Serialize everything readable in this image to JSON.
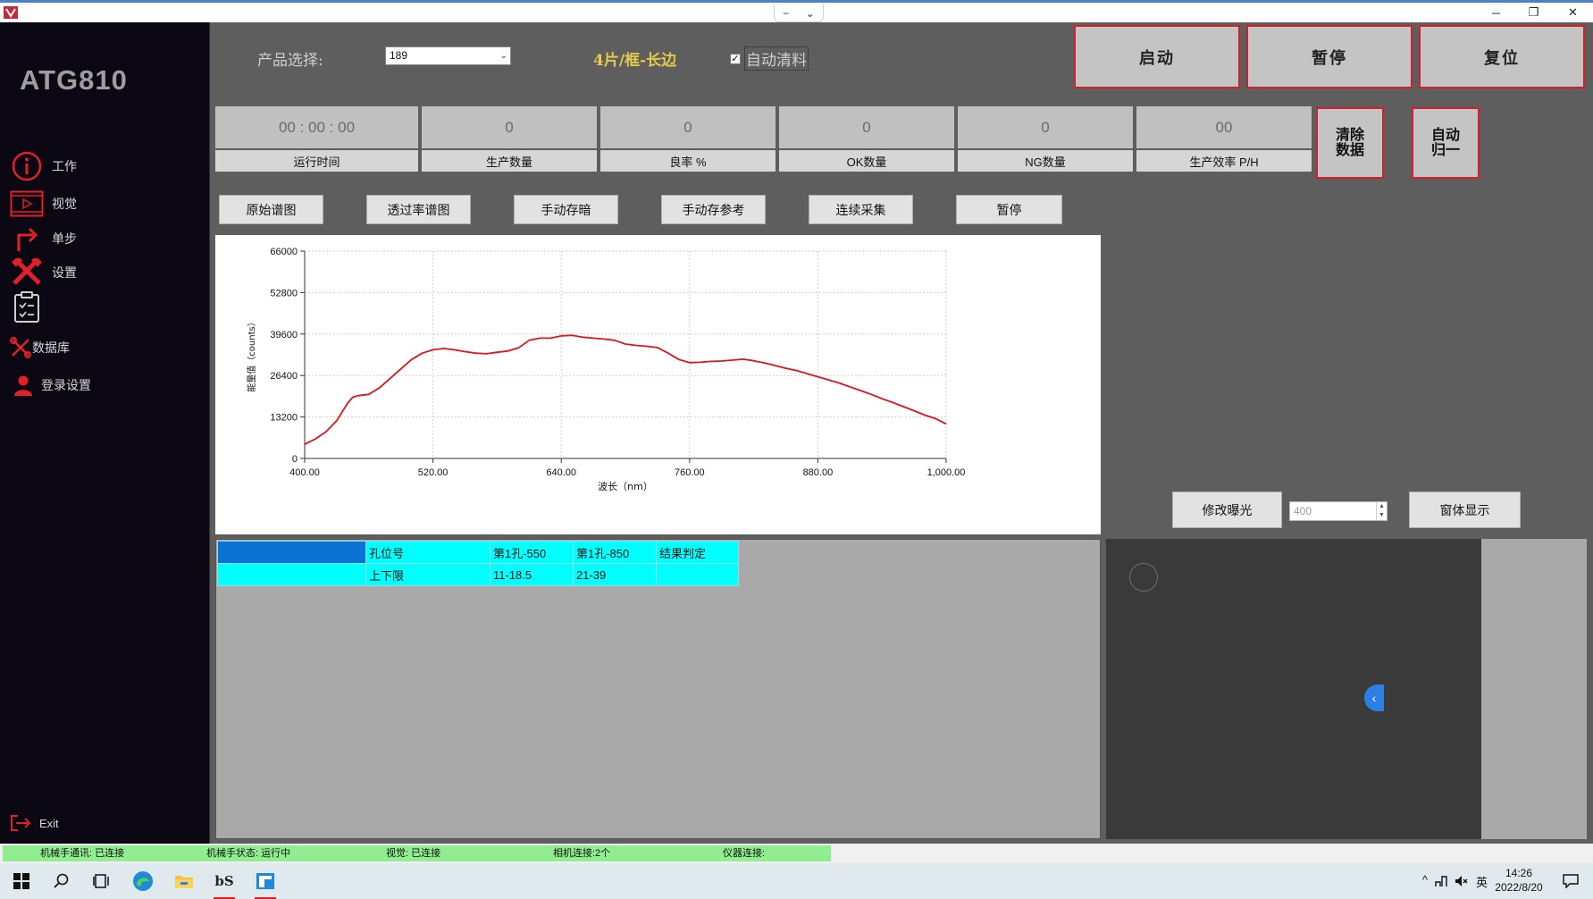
{
  "window": {
    "minimize": "─",
    "restore": "❐",
    "close": "✕",
    "dropdown_left": "−",
    "dropdown_right": "⌄"
  },
  "sidebar": {
    "brand": "ATG810",
    "items": [
      {
        "label": "工作",
        "icon": "info-icon"
      },
      {
        "label": "视觉",
        "icon": "video-icon"
      },
      {
        "label": "单步",
        "icon": "step-arrow-icon"
      },
      {
        "label": "设置",
        "icon": "tools-icon"
      },
      {
        "label": "",
        "icon": "clipboard-check-icon"
      },
      {
        "label": "数据库",
        "icon": "wrench-screwdriver-icon"
      },
      {
        "label": "登录设置",
        "icon": "user-icon"
      }
    ],
    "exit_label": "Exit"
  },
  "header": {
    "product_label": "产品选择:",
    "product_value": "189",
    "mode_text": "4片/框-长边",
    "auto_clear_label": "自动清料",
    "auto_clear_checked": true
  },
  "controls": {
    "start": "启动",
    "pause": "暂停",
    "reset": "复位"
  },
  "stats": [
    {
      "value": "00 : 00 : 00",
      "label": "运行时间"
    },
    {
      "value": "0",
      "label": "生产数量"
    },
    {
      "value": "0",
      "label": "良率 %"
    },
    {
      "value": "0",
      "label": "OK数量"
    },
    {
      "value": "0",
      "label": "NG数量"
    },
    {
      "value": "00",
      "label": "生产效率 P/H"
    }
  ],
  "actions": {
    "clear_data": "清除\n数据",
    "auto_home": "自动\n归一"
  },
  "tools": [
    "原始谱图",
    "透过率谱图",
    "手动存暗",
    "手动存参考",
    "连续采集",
    "暂停"
  ],
  "chart_data": {
    "type": "line",
    "xlabel": "波长（nm）",
    "ylabel": "能量值（counts）",
    "xlim": [
      400,
      1000
    ],
    "ylim": [
      0,
      66000
    ],
    "xticks": [
      "400.00",
      "520.00",
      "640.00",
      "760.00",
      "880.00",
      "1,000.00"
    ],
    "yticks": [
      "0",
      "13200",
      "26400",
      "39600",
      "52800",
      "66000"
    ],
    "grid": true,
    "color": "#e0141c",
    "series": [
      {
        "x": [
          400,
          410,
          420,
          430,
          440,
          445,
          450,
          460,
          470,
          480,
          490,
          500,
          510,
          520,
          530,
          540,
          550,
          560,
          570,
          580,
          590,
          600,
          610,
          620,
          630,
          640,
          650,
          660,
          670,
          680,
          690,
          700,
          710,
          720,
          730,
          740,
          750,
          760,
          770,
          780,
          790,
          800,
          810,
          820,
          830,
          840,
          850,
          860,
          870,
          880,
          890,
          900,
          910,
          920,
          930,
          940,
          950,
          960,
          970,
          980,
          990,
          1000
        ],
        "y": [
          4500,
          6200,
          8500,
          12000,
          17500,
          19500,
          20000,
          20400,
          22500,
          25500,
          28500,
          31500,
          33500,
          34600,
          35000,
          34600,
          34000,
          33500,
          33300,
          33800,
          34200,
          35200,
          37600,
          38300,
          38300,
          39000,
          39200,
          38600,
          38300,
          38000,
          37600,
          36400,
          36000,
          35700,
          35300,
          33500,
          31500,
          30500,
          30600,
          30900,
          31000,
          31300,
          31600,
          31100,
          30400,
          29600,
          28700,
          28000,
          27000,
          26000,
          25000,
          24000,
          22800,
          21600,
          20400,
          19000,
          17800,
          16500,
          15200,
          13800,
          12700,
          11000
        ]
      }
    ]
  },
  "exposure": {
    "button": "修改曝光",
    "value": "400",
    "window_button": "窗体显示"
  },
  "table": {
    "rows": [
      [
        "",
        "孔位号",
        "第1孔-550",
        "第1孔-850",
        "结果判定"
      ],
      [
        "",
        "上下限",
        "11-18.5",
        "21-39",
        ""
      ]
    ]
  },
  "statusbar": [
    "机械手通讯: 已连接",
    "机械手状态: 运行中",
    "视觉: 已连接",
    "相机连接:2个",
    "仪器连接:"
  ],
  "taskbar": {
    "icons": [
      "windows-start-icon",
      "search-icon",
      "task-view-icon",
      "edge-browser-icon",
      "file-explorer-icon",
      "app-bs-icon",
      "app-window-icon"
    ],
    "tray_caret": "^",
    "tray_lang": "英",
    "time": "14:26",
    "date": "2022/8/20"
  }
}
